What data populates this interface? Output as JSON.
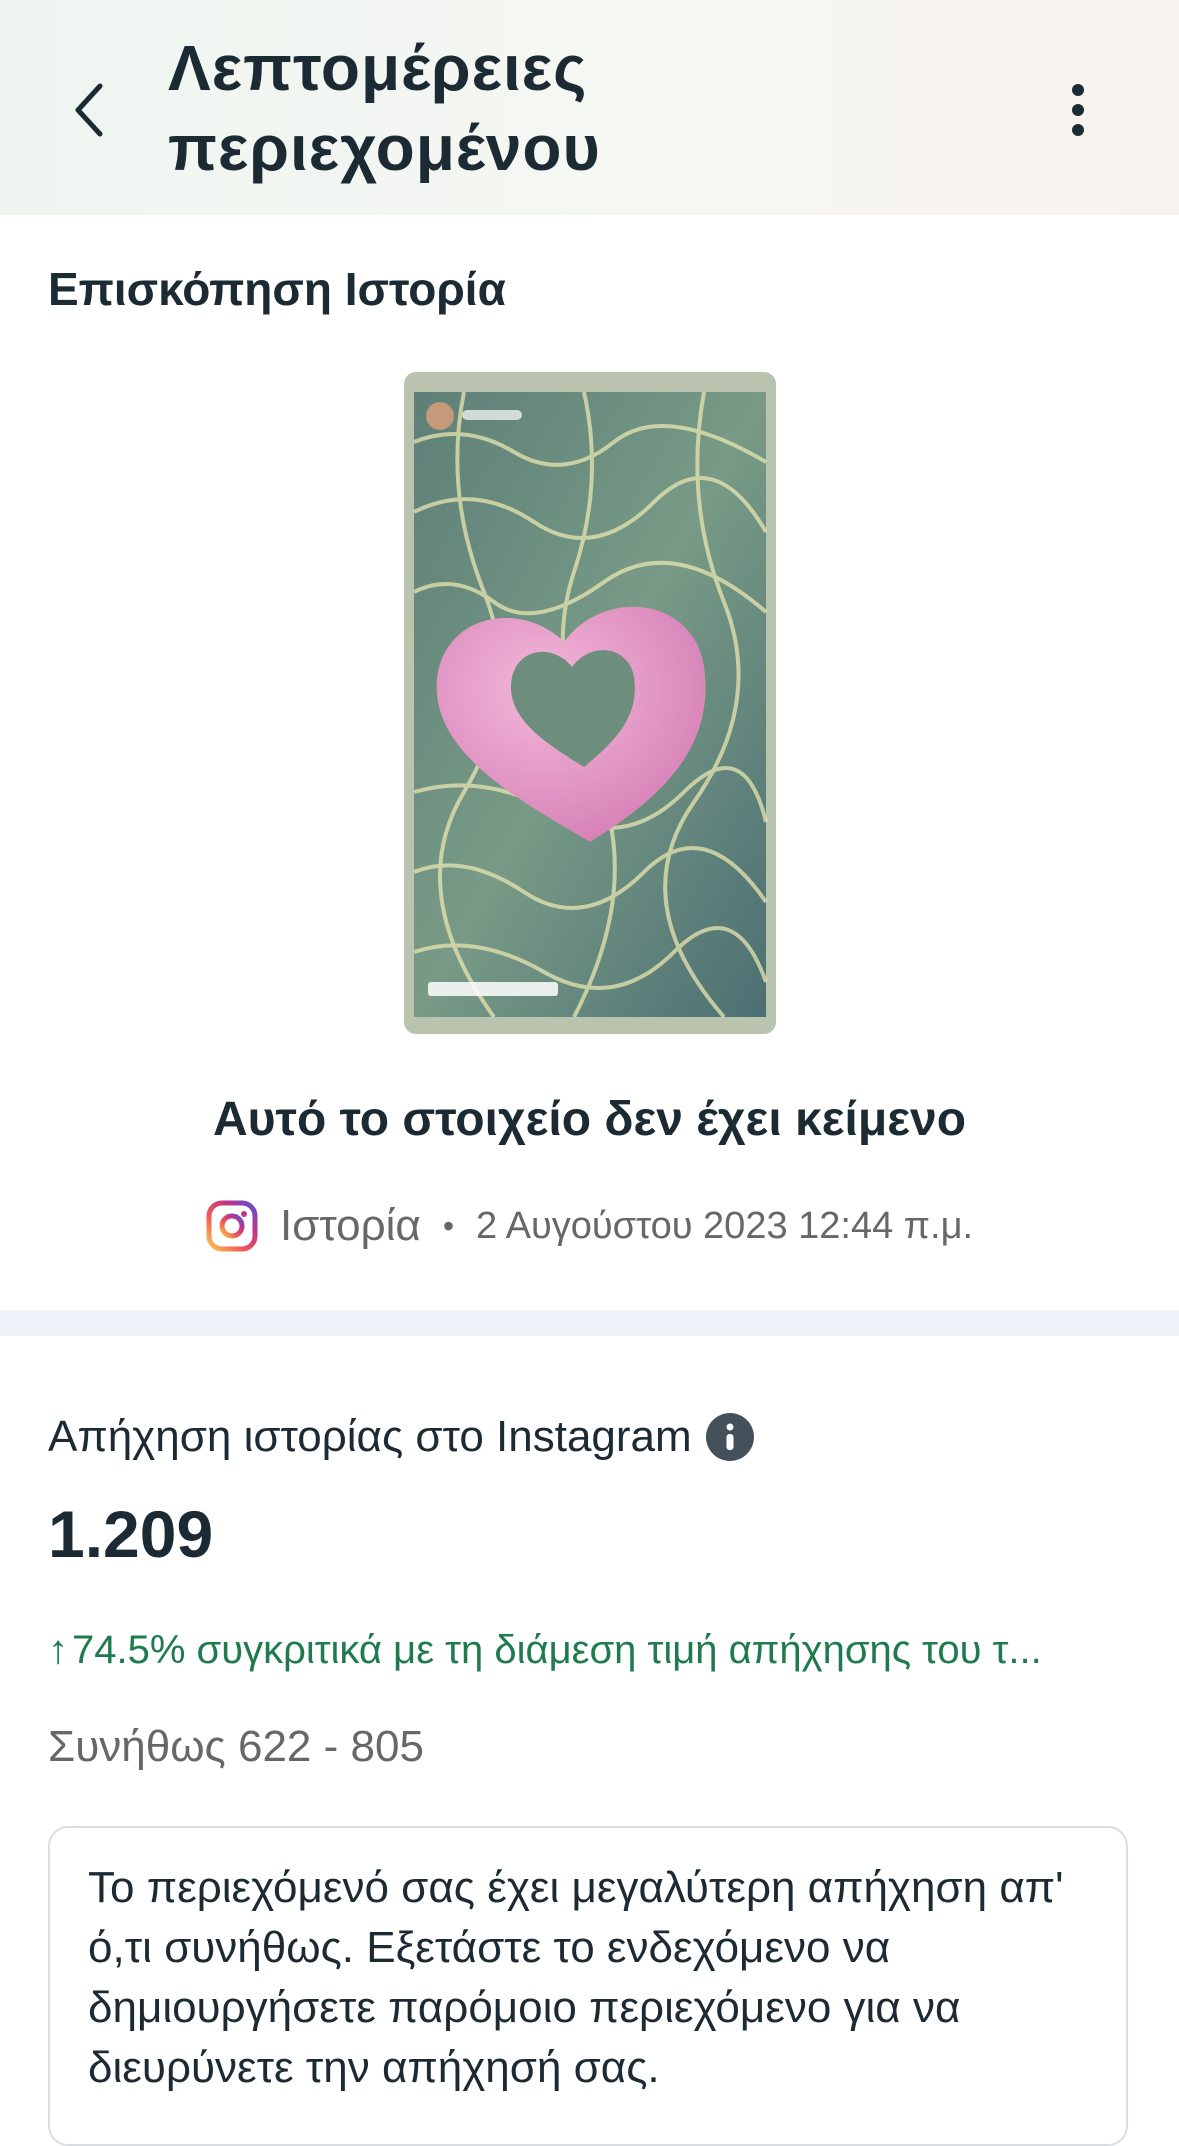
{
  "header": {
    "title_line1": "Λεπτομέρειες",
    "title_line2": "περιεχομένου",
    "back_icon": "chevron-left-icon",
    "more_icon": "more-vertical-icon"
  },
  "preview_section": {
    "title": "Επισκόπηση Ιστορία",
    "no_text_label": "Αυτό το στοιχείο δεν έχει κείμενο"
  },
  "meta": {
    "platform_icon": "instagram-icon",
    "platform": "Ιστορία",
    "separator": "•",
    "date": "2 Αυγούστου 2023 12:44 π.μ."
  },
  "metric": {
    "label": "Απήχηση ιστορίας στο Instagram",
    "info_icon": "info-icon",
    "value": "1.209",
    "comparison_arrow": "↑",
    "comparison_text": "74.5% συγκριτικά με τη διάμεση τιμή απήχησης του τ...",
    "usual_range": "Συνήθως 622 - 805",
    "positive_color": "#1f7a4d"
  },
  "tip": {
    "text": "Το περιεχόμενό σας έχει μεγαλύτερη απήχηση απ' ό,τι συνήθως. Εξετάστε το ενδεχόμενο να δημιουργήσετε παρόμοιο περιεχόμενο για να διευρύνετε την απήχησή σας."
  }
}
